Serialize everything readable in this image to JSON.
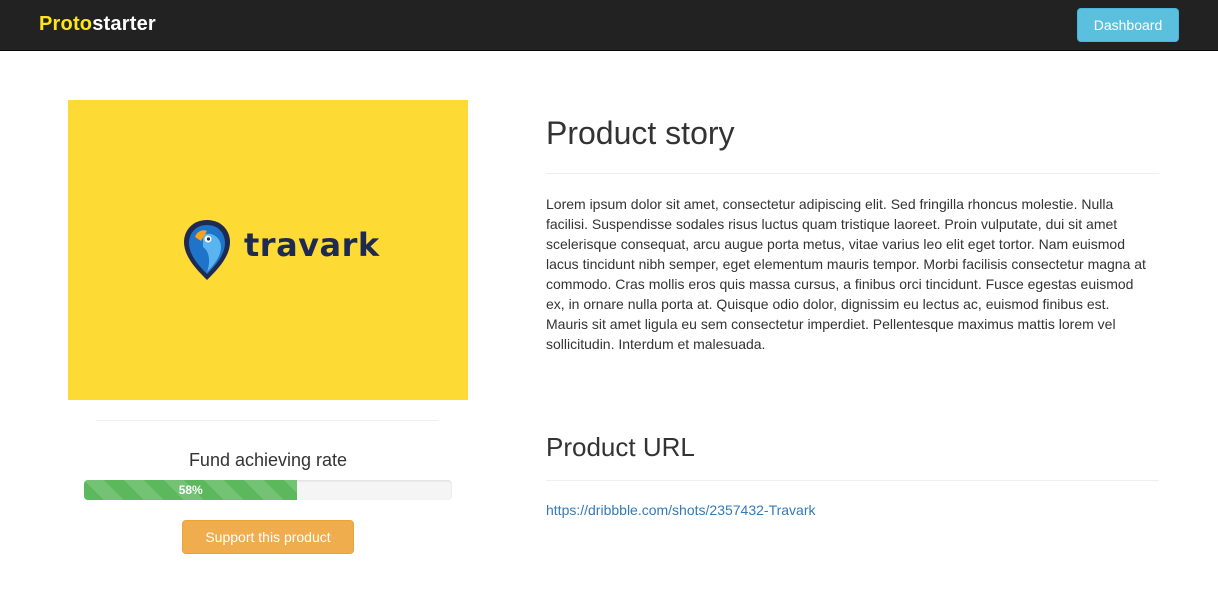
{
  "navbar": {
    "brand_part1": "Proto",
    "brand_part2": "starter",
    "dashboard_label": "Dashboard"
  },
  "product": {
    "logo_text": "travark",
    "fund_label": "Fund achieving rate",
    "progress_percent": 58,
    "progress_label": "58%",
    "support_label": "Support this product"
  },
  "story": {
    "heading": "Product story",
    "body": "Lorem ipsum dolor sit amet, consectetur adipiscing elit. Sed fringilla rhoncus molestie. Nulla facilisi. Suspendisse sodales risus luctus quam tristique laoreet. Proin vulputate, dui sit amet scelerisque consequat, arcu augue porta metus, vitae varius leo elit eget tortor. Nam euismod lacus tincidunt nibh semper, eget elementum mauris tempor. Morbi facilisis consectetur magna at commodo. Cras mollis eros quis massa cursus, a finibus orci tincidunt. Fusce egestas euismod ex, in ornare nulla porta at. Quisque odio dolor, dignissim eu lectus ac, euismod finibus est. Mauris sit amet ligula eu sem consectetur imperdiet. Pellentesque maximus mattis lorem vel sollicitudin. Interdum et malesuada."
  },
  "url_section": {
    "heading": "Product URL",
    "link_text": "https://dribbble.com/shots/2357432-Travark"
  },
  "colors": {
    "navbar_bg": "#222222",
    "brand_accent": "#fde41e",
    "info_button": "#5bc0de",
    "image_bg": "#fdda34",
    "progress_success": "#5cb85c",
    "warning_button": "#f0ad4e",
    "link": "#337ab7"
  },
  "icons": {
    "logo": "travark-bird-logo-icon"
  }
}
